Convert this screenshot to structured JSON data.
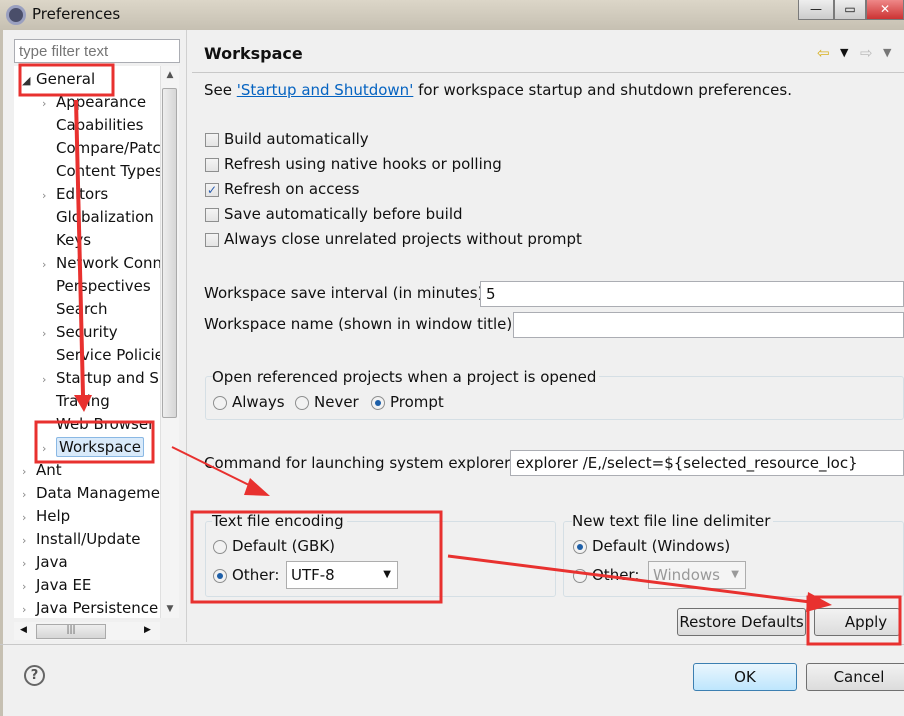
{
  "window": {
    "title": "Preferences",
    "icon": "eclipse-gear-icon",
    "controls": [
      "minimize",
      "maximize",
      "close"
    ]
  },
  "filter": {
    "placeholder": "type filter text"
  },
  "tree": {
    "general": "General",
    "general_children": [
      {
        "label": "Appearance",
        "expandable": true
      },
      {
        "label": "Capabilities",
        "expandable": false
      },
      {
        "label": "Compare/Patch",
        "expandable": false
      },
      {
        "label": "Content Types",
        "expandable": false
      },
      {
        "label": "Editors",
        "expandable": true
      },
      {
        "label": "Globalization",
        "expandable": false
      },
      {
        "label": "Keys",
        "expandable": false
      },
      {
        "label": "Network Connections",
        "expandable": true
      },
      {
        "label": "Perspectives",
        "expandable": false
      },
      {
        "label": "Search",
        "expandable": false
      },
      {
        "label": "Security",
        "expandable": true
      },
      {
        "label": "Service Policies",
        "expandable": false
      },
      {
        "label": "Startup and Shutdown",
        "expandable": true
      },
      {
        "label": "Tracing",
        "expandable": false
      },
      {
        "label": "Web Browser",
        "expandable": false
      },
      {
        "label": "Workspace",
        "expandable": true,
        "selected": true
      }
    ],
    "top_level": [
      "Ant",
      "Data Management",
      "Help",
      "Install/Update",
      "Java",
      "Java EE",
      "Java Persistence"
    ]
  },
  "page": {
    "title": "Workspace",
    "intro_prefix": "See ",
    "intro_link": "'Startup and Shutdown'",
    "intro_suffix": " for workspace startup and shutdown preferences.",
    "checkboxes": [
      {
        "label": "Build automatically",
        "checked": false
      },
      {
        "label": "Refresh using native hooks or polling",
        "checked": false
      },
      {
        "label": "Refresh on access",
        "checked": true
      },
      {
        "label": "Save automatically before build",
        "checked": false
      },
      {
        "label": "Always close unrelated projects without prompt",
        "checked": false
      }
    ],
    "save_interval_label": "Workspace save interval (in minutes):",
    "save_interval_value": "5",
    "workspace_name_label": "Workspace name (shown in window title):",
    "workspace_name_value": "",
    "open_ref": {
      "label": "Open referenced projects when a project is opened",
      "options": [
        "Always",
        "Never",
        "Prompt"
      ],
      "selected": "Prompt"
    },
    "explorer_label": "Command for launching system explorer:",
    "explorer_value": "explorer /E,/select=${selected_resource_loc}",
    "encoding": {
      "label": "Text file encoding",
      "default": "Default (GBK)",
      "other": "Other:",
      "selected": "Other",
      "value": "UTF-8"
    },
    "delimiter": {
      "label": "New text file line delimiter",
      "default": "Default (Windows)",
      "other": "Other:",
      "selected": "Default",
      "value": "Windows"
    },
    "restore_defaults": "Restore Defaults",
    "apply": "Apply"
  },
  "footer": {
    "ok": "OK",
    "cancel": "Cancel",
    "help_icon": "?"
  },
  "annotation_color": "#e8312f"
}
